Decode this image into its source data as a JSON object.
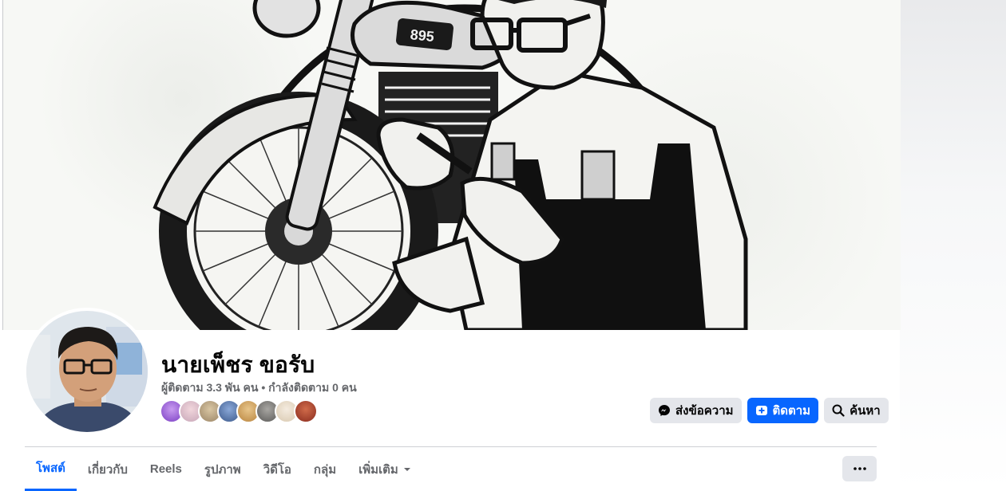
{
  "cover": {
    "tank_badge": "895",
    "description": "Black and white illustration of a mechanic with glasses repairing a motorcycle"
  },
  "profile": {
    "name": "นายเพ็ชร ขอรับ",
    "stats": "ผู้ติดตาม 3.3 พัน คน • กำลังติดตาม 0 คน",
    "follower_avatar_colors": [
      "#7b3fc4",
      "#c7a6b8",
      "#9b8566",
      "#3d5a8c",
      "#b9853f",
      "#5b5a58",
      "#d9c9b0",
      "#8a2c1f"
    ]
  },
  "actions": {
    "message_label": "ส่งข้อความ",
    "follow_label": "ติดตาม",
    "search_label": "ค้นหา"
  },
  "tabs": [
    {
      "label": "โพสต์",
      "active": true
    },
    {
      "label": "เกี่ยวกับ",
      "active": false
    },
    {
      "label": "Reels",
      "active": false
    },
    {
      "label": "รูปภาพ",
      "active": false
    },
    {
      "label": "วิดีโอ",
      "active": false
    },
    {
      "label": "กลุ่ม",
      "active": false
    },
    {
      "label": "เพิ่มเติม",
      "active": false
    }
  ],
  "colors": {
    "accent": "#0866ff",
    "button_grey": "#e4e6eb",
    "muted_text": "#65676b"
  }
}
